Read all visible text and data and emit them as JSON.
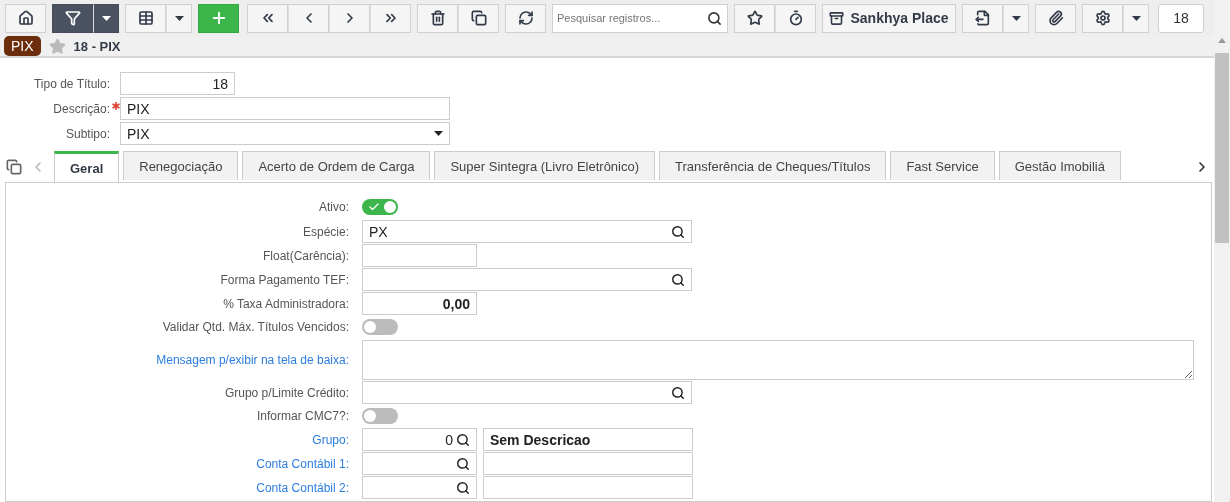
{
  "toolbar": {
    "search": {
      "placeholder": "Pesquisar registros..."
    },
    "place_button": "Sankhya Place",
    "record_count": "18"
  },
  "breadcrumb": {
    "badge": "PIX",
    "favorite": false,
    "title": "18 - PIX"
  },
  "header_fields": [
    {
      "kind": "number",
      "label": "Tipo de Título:",
      "value": "18",
      "required": false
    },
    {
      "kind": "text",
      "label": "Descrição:",
      "value": "PIX",
      "required": true
    },
    {
      "kind": "select",
      "label": "Subtipo:",
      "value": "PIX",
      "required": false
    }
  ],
  "tabs": [
    {
      "label": "Geral",
      "selected": true
    },
    {
      "label": "Renegociação",
      "selected": false
    },
    {
      "label": "Acerto de Ordem de Carga",
      "selected": false
    },
    {
      "label": "Super Sintegra (Livro Eletrônico)",
      "selected": false
    },
    {
      "label": "Transferência de Cheques/Títulos",
      "selected": false
    },
    {
      "label": "Fast Service",
      "selected": false
    },
    {
      "label": "Gestão Imobiliá",
      "selected": false
    }
  ],
  "fields": [
    {
      "kind": "toggle",
      "label": "Ativo:",
      "link": false,
      "on": true
    },
    {
      "kind": "lookup",
      "label": "Espécie:",
      "link": false,
      "value": "PX"
    },
    {
      "kind": "text",
      "label": "Float(Carência):",
      "link": false
    },
    {
      "kind": "lookup",
      "label": "Forma Pagamento TEF:",
      "link": false
    },
    {
      "kind": "number",
      "label": "% Taxa Administradora:",
      "link": false,
      "value": "0,00"
    },
    {
      "kind": "toggle",
      "label": "Validar Qtd. Máx. Títulos Vencidos:",
      "link": false,
      "on": false
    },
    {
      "kind": "textarea",
      "label": "Mensagem p/exibir na tela de baixa:",
      "link": true
    },
    {
      "kind": "lookup",
      "label": "Grupo p/Limite Crédito:",
      "link": false
    },
    {
      "kind": "toggle",
      "label": "Informar CMC7?:",
      "link": false,
      "on": false
    },
    {
      "kind": "code",
      "label": "Grupo:",
      "link": true,
      "value": "0",
      "description": "Sem Descricao"
    },
    {
      "kind": "code",
      "label": "Conta Contábil 1:",
      "link": true
    },
    {
      "kind": "code",
      "label": "Conta Contábil 2:",
      "link": true
    }
  ]
}
